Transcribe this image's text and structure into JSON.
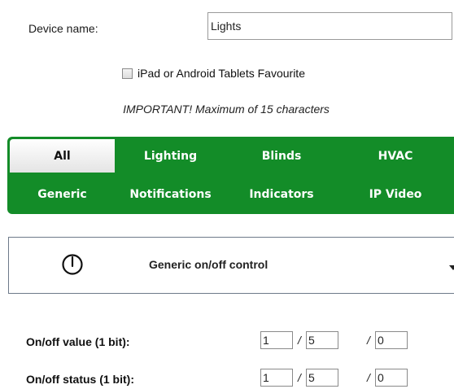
{
  "device": {
    "label": "Device name:",
    "value": "Lights"
  },
  "favourite": {
    "label": "iPad or Android Tablets Favourite",
    "checked": false
  },
  "notice": "IMPORTANT! Maximum of 15 characters",
  "categories": {
    "selected": "All",
    "row1": [
      "All",
      "Lighting",
      "Blinds",
      "HVAC"
    ],
    "row2": [
      "Generic",
      "Notifications",
      "Indicators",
      "IP Video"
    ],
    "color": "#138c28"
  },
  "control": {
    "label": "Generic on/off control",
    "icon": "power-icon"
  },
  "addresses": [
    {
      "label": "On/off value (1 bit):",
      "a": "1",
      "b": "5",
      "c": "0",
      "separator": "/"
    },
    {
      "label": "On/off status (1 bit):",
      "a": "1",
      "b": "5",
      "c": "0",
      "separator": "/"
    }
  ]
}
